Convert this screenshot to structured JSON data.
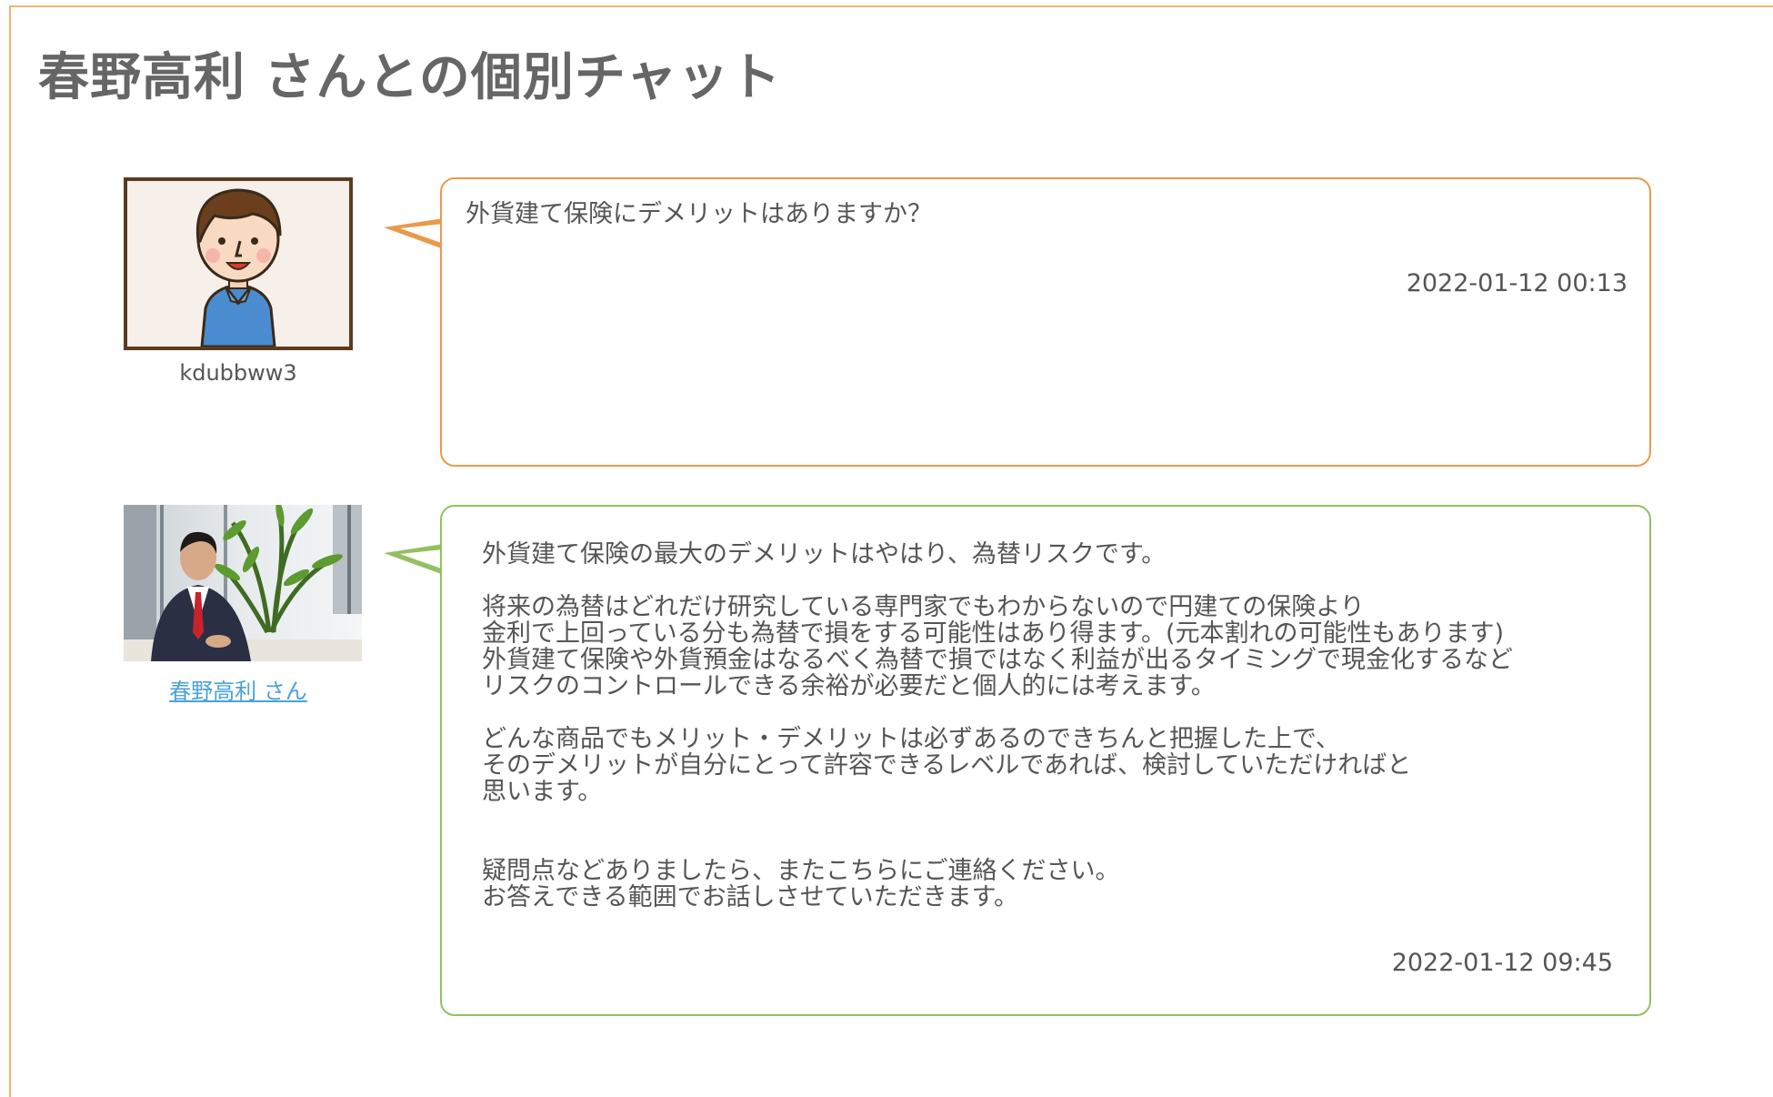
{
  "page": {
    "title": "春野高利 さんとの個別チャット"
  },
  "messages": [
    {
      "author": "kdubbww3",
      "avatar": "cartoon-user-avatar",
      "text": "外貨建て保険にデメリットはありますか？",
      "timestamp": "2022-01-12 00:13",
      "accent": "#e89a4a"
    },
    {
      "author": "春野高利 さん",
      "avatar": "expert-photo",
      "text": "外貨建て保険の最大のデメリットはやはり、為替リスクです。\n\n将来の為替はどれだけ研究している専門家でもわからないので円建ての保険より\n金利で上回っている分も為替で損をする可能性はあり得ます。(元本割れの可能性もあります)\n外貨建て保険や外貨預金はなるべく為替で損ではなく利益が出るタイミングで現金化するなど\nリスクのコントロールできる余裕が必要だと個人的には考えます。\n\nどんな商品でもメリット・デメリットは必ずあるのできちんと把握した上で、\nそのデメリットが自分にとって許容できるレベルであれば、検討していただければと\n思います。\n\n\n疑問点などありましたら、またこちらにご連絡ください。\nお答えできる範囲でお話しさせていただきます。",
      "timestamp": "2022-01-12 09:45",
      "accent": "#93c060"
    }
  ]
}
